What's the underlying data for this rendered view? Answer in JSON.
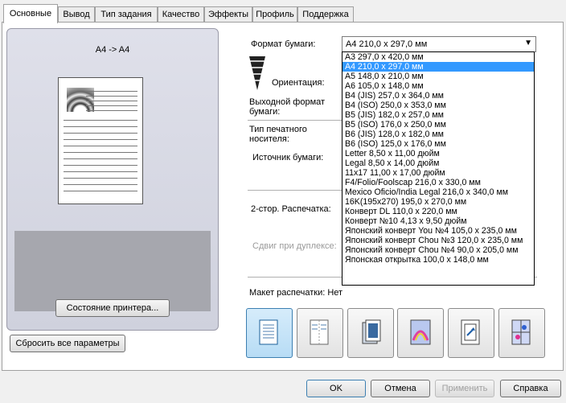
{
  "tabs": [
    "Основные",
    "Вывод",
    "Тип задания",
    "Качество",
    "Эффекты",
    "Профиль",
    "Поддержка"
  ],
  "preview": {
    "title": "A4 -> A4",
    "printer_status_button": "Состояние принтера..."
  },
  "reset_button": "Сбросить все параметры",
  "paper_format": {
    "label": "Формат бумаги:",
    "selected": "A4   210,0 x 297,0 мм",
    "options": [
      "A3   297,0 x 420,0 мм",
      "A4   210,0 x 297,0 мм",
      "A5   148,0 x 210,0 мм",
      "A6   105,0 x 148,0 мм",
      "B4 (JIS)   257,0 x 364,0 мм",
      "B4 (ISO)   250,0 x 353,0 мм",
      "B5 (JIS)   182,0 x 257,0 мм",
      "B5 (ISO)   176,0 x 250,0 мм",
      "B6 (JIS)   128,0 x 182,0 мм",
      "B6 (ISO)   125,0 x 176,0 мм",
      "Letter   8,50 x 11,00 дюйм",
      "Legal   8,50 x 14,00 дюйм",
      "11x17   11,00 x 17,00 дюйм",
      "F4/Folio/Foolscap   216,0 x 330,0 мм",
      "Mexico Oficio/India Legal   216,0 x 340,0 мм",
      "16K(195x270)   195,0 x 270,0 мм",
      "Конверт DL   110,0 x 220,0 мм",
      "Конверт №10   4,13 x 9,50 дюйм",
      "Японский конверт You №4   105,0 x 235,0 мм",
      "Японский конверт Chou №3   120,0 x 235,0 мм",
      "Японский конверт Chou №4   90,0 x 205,0 мм",
      "Японская открытка   100,0 x 148,0 мм"
    ],
    "selected_index": 1
  },
  "labels": {
    "orientation": "Ориентация:",
    "output_format_1": "Выходной формат",
    "output_format_2": "бумаги:",
    "media_type_1": "Тип печатного",
    "media_type_2": "носителя:",
    "paper_source": "Источник бумаги:",
    "duplex": "2-стор. Распечатка:",
    "duplex_shift": "Сдвиг при дуплексе:",
    "layout": "Макет распечатки: Нет"
  },
  "footer": {
    "ok": "OK",
    "cancel": "Отмена",
    "apply": "Применить",
    "help": "Справка"
  }
}
